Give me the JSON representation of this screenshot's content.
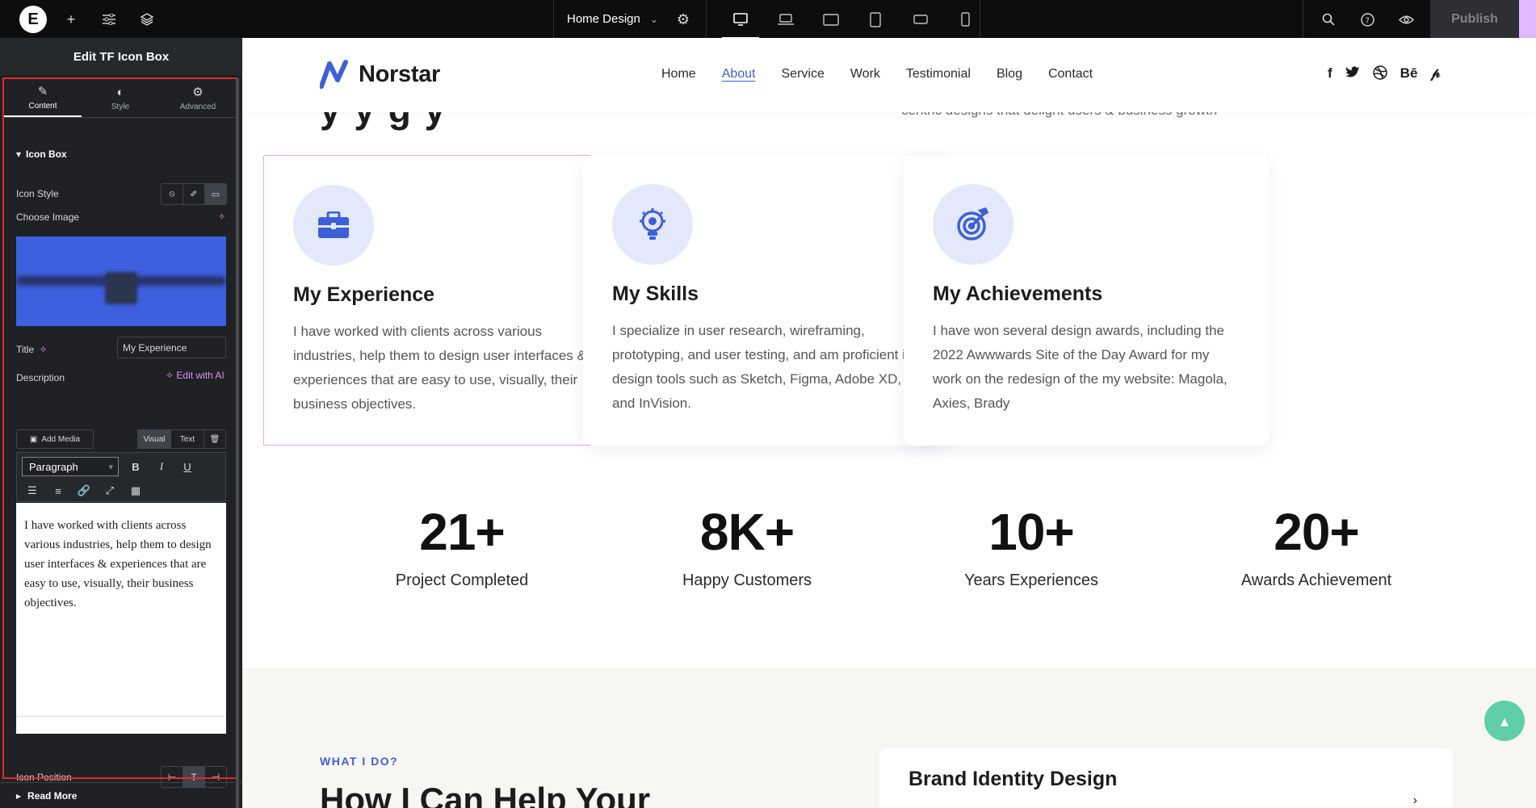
{
  "topbar": {
    "document_name": "Home Design",
    "publish_label": "Publish"
  },
  "panel": {
    "title": "Edit TF Icon Box",
    "tabs": [
      {
        "label": "Content",
        "icon": "pencil-icon"
      },
      {
        "label": "Style",
        "icon": "half-circle-icon"
      },
      {
        "label": "Advanced",
        "icon": "gear-icon"
      }
    ],
    "section_icon_box": "Icon Box",
    "icon_style_label": "Icon Style",
    "choose_image_label": "Choose Image",
    "title_label": "Title",
    "title_value": "My Experience",
    "description_label": "Description",
    "edit_with_ai": "Edit with AI",
    "add_media": "Add Media",
    "visual_tab": "Visual",
    "text_tab": "Text",
    "format_select": "Paragraph",
    "editor_content": "I have worked with clients across various industries, help them to design user interfaces & experiences that are easy to use, visually, their business objectives.",
    "icon_position_label": "Icon Position",
    "section_read_more": "Read More"
  },
  "site": {
    "brand": "Norstar",
    "nav": [
      "Home",
      "About",
      "Service",
      "Work",
      "Testimonial",
      "Blog",
      "Contact"
    ],
    "active_nav": "About",
    "partial_heading": "y y g y",
    "partial_subtext": "centric designs that delight users & business growth",
    "cards": [
      {
        "title": "My Experience",
        "desc": "I have worked with clients across various industries, help them to design user interfaces & experiences that are easy to use, visually, their business objectives.",
        "icon": "briefcase-icon"
      },
      {
        "title": "My Skills",
        "desc": "I specialize in user research, wireframing, prototyping, and user testing, and am proficient in design tools such as Sketch, Figma, Adobe XD, and InVision.",
        "icon": "lightbulb-gear-icon"
      },
      {
        "title": "My Achievements",
        "desc": "I have won several design awards, including the 2022 Awwwards Site of the Day Award for my work on the redesign of the my website: Magola, Axies, Brady",
        "icon": "target-icon"
      }
    ],
    "stats": [
      {
        "value": "21+",
        "label": "Project Completed"
      },
      {
        "value": "8K+",
        "label": "Happy Customers"
      },
      {
        "value": "10+",
        "label": "Years Experiences"
      },
      {
        "value": "20+",
        "label": "Awards Achievement"
      }
    ],
    "eyebrow": "WHAT I DO?",
    "services_heading": "How I Can Help Your",
    "service_card_title": "Brand Identity Design"
  },
  "colors": {
    "accent": "#3f5fd6",
    "selection": "#e4a6ee",
    "highlight": "#e8262c",
    "fab": "#5fcfa8"
  }
}
